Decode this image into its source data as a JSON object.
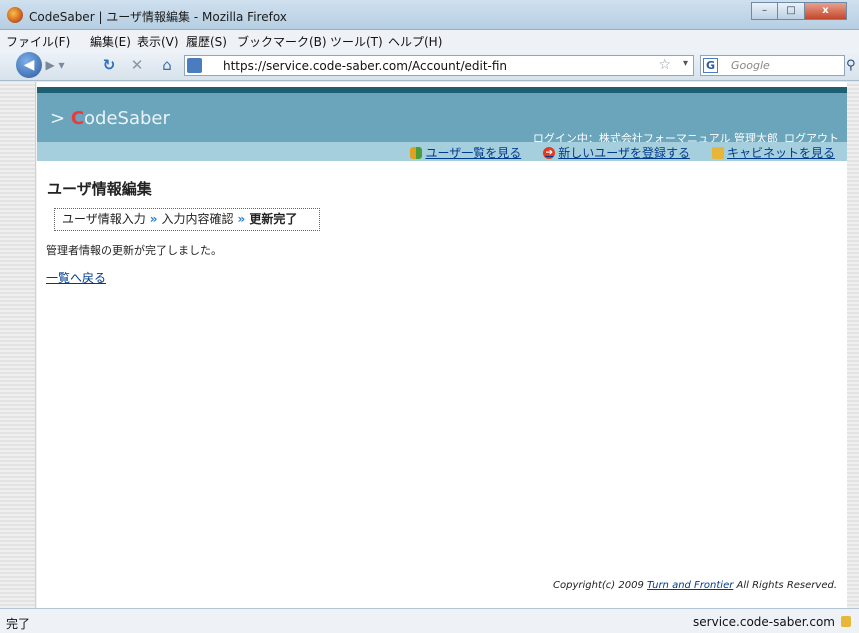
{
  "window": {
    "title": "CodeSaber | ユーザ情報編集 - Mozilla Firefox",
    "minimize": "–",
    "maximize": "□",
    "close": "x"
  },
  "menubar": {
    "items": [
      "ファイル(F)",
      "編集(E)",
      "表示(V)",
      "履歴(S)",
      "ブックマーク(B)",
      "ツール(T)",
      "ヘルプ(H)"
    ]
  },
  "navbar": {
    "url": "https://service.code-saber.com/Account/edit-fin",
    "search_placeholder": "Google",
    "search_engine": "G"
  },
  "header": {
    "logo_prefix": "> ",
    "logo_c": "C",
    "logo_rest": "odeSaber",
    "login_label": "ログイン中：株式会社フォーマニュアル 管理太郎",
    "logout": "ログアウト",
    "links": [
      {
        "label": "ユーザ一覧を見る",
        "icon": "users-icon"
      },
      {
        "label": "新しいユーザを登録する",
        "icon": "add-icon"
      },
      {
        "label": "キャビネットを見る",
        "icon": "folder-icon"
      }
    ]
  },
  "main": {
    "title": "ユーザ情報編集",
    "steps": [
      "ユーザ情報入力",
      "入力内容確認",
      "更新完了"
    ],
    "step_arrow": "»",
    "message": "管理者情報の更新が完了しました。",
    "back_link": "一覧へ戻る"
  },
  "footer": {
    "copyright_prefix": "Copyright(c) 2009 ",
    "copyright_link": "Turn and Frontier",
    "copyright_suffix": " All Rights Reserved."
  },
  "statusbar": {
    "left": "完了",
    "right": "service.code-saber.com"
  },
  "colors": {
    "header": "#6aa5bb",
    "header_top": "#1f5f72",
    "subheader": "#a6cfdd",
    "link": "#003a8c"
  }
}
